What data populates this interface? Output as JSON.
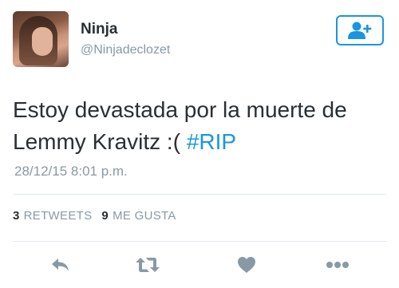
{
  "user": {
    "display_name": "Ninja",
    "handle": "@Ninjadeclozet"
  },
  "follow_button": {
    "icon": "follow-user-icon"
  },
  "tweet": {
    "text": "Estoy devastada por la muerte de Lemmy Kravitz :( ",
    "hashtag": "#RIP",
    "timestamp": "28/12/15 8:01 p.m."
  },
  "stats": {
    "retweets_count": "3",
    "retweets_label": "RETWEETS",
    "likes_count": "9",
    "likes_label": "ME GUSTA"
  },
  "actions": [
    {
      "icon": "reply-icon"
    },
    {
      "icon": "retweet-icon"
    },
    {
      "icon": "heart-icon"
    },
    {
      "icon": "more-icon"
    }
  ],
  "colors": {
    "accent": "#1b95e0",
    "icon_gray": "#8899a6",
    "text": "#292f33"
  }
}
